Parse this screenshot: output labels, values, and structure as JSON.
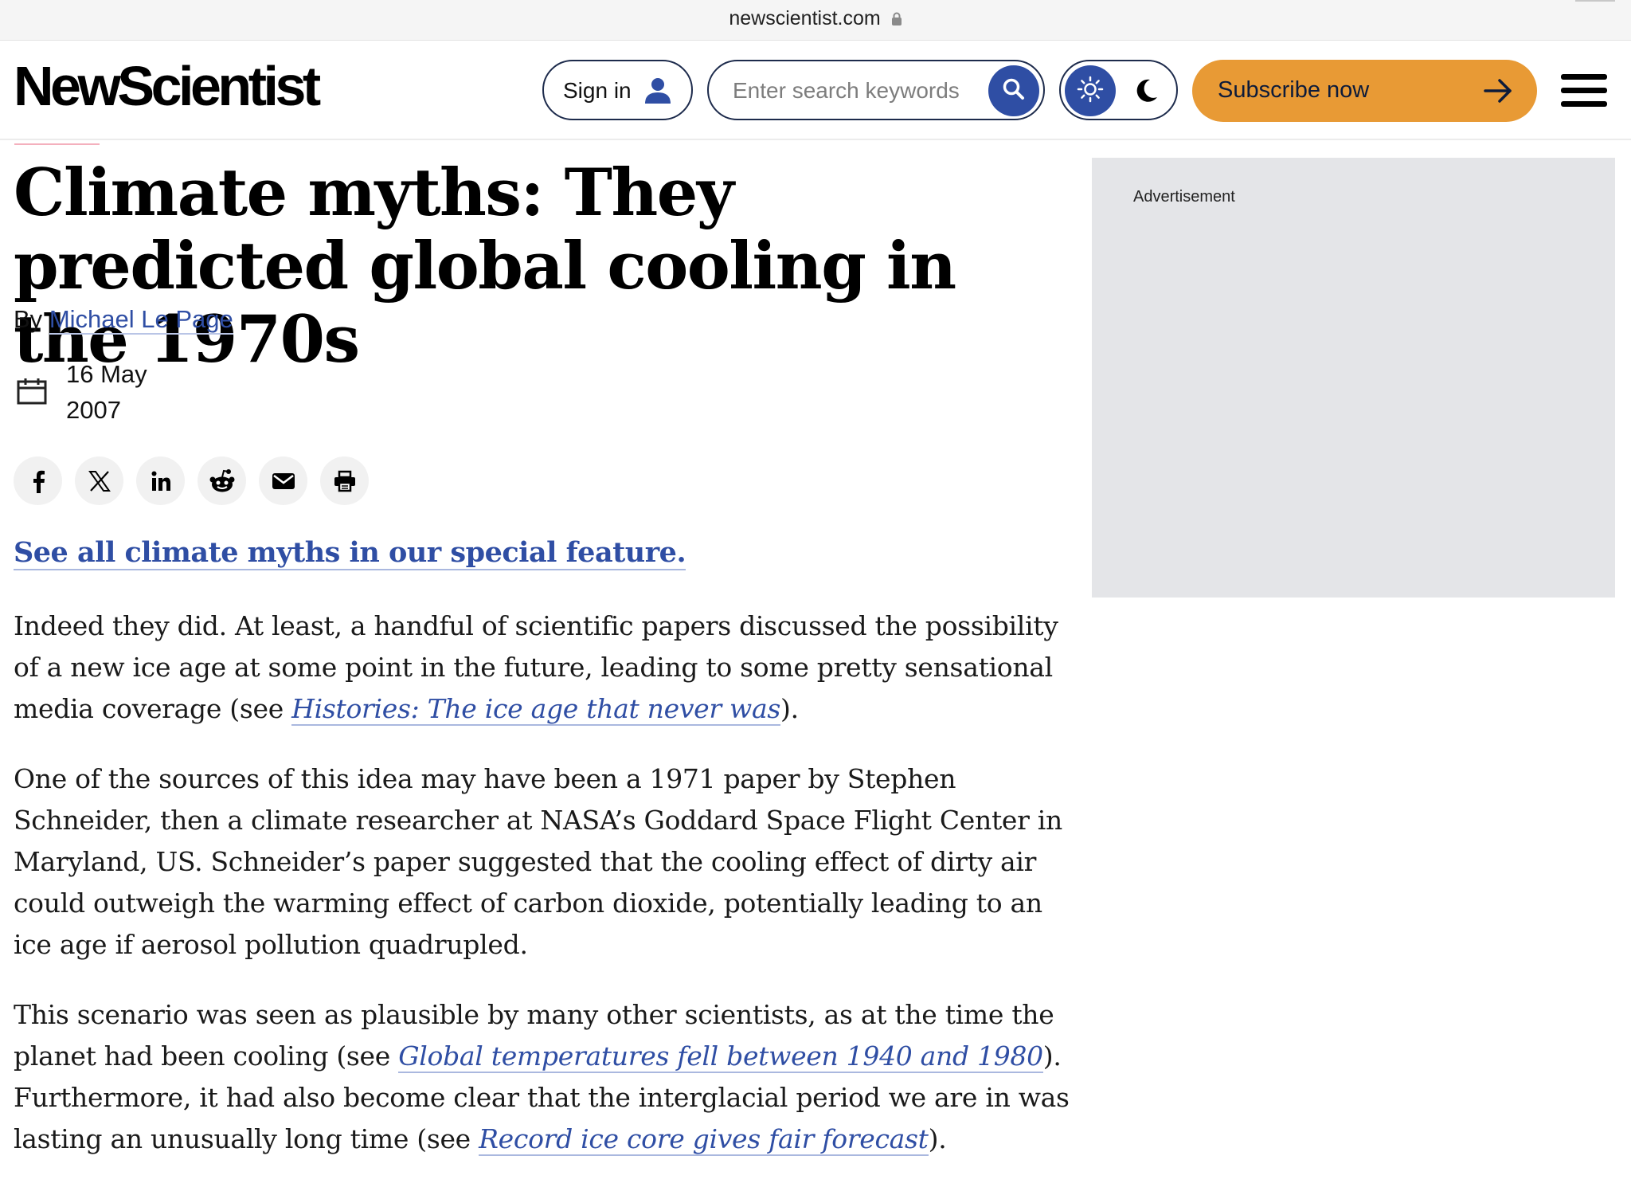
{
  "browser": {
    "url": "newscientist.com"
  },
  "header": {
    "logo": "NewScientist",
    "sign_in_label": "Sign in",
    "search_placeholder": "Enter search keywords",
    "subscribe_label": "Subscribe now"
  },
  "article": {
    "title": "Climate myths: They predicted global cooling in the 1970s",
    "byline_prefix": "By",
    "author": "Michael Le Page",
    "date": "16 May 2007",
    "special_feature_link": "See all climate myths in our special feature.",
    "paragraphs": [
      {
        "before": "Indeed they did. At least, a handful of scientific papers discussed the possibility of a new ice age at some point in the future, leading to some pretty sensational media coverage (see ",
        "link": "Histories: The ice age that never was",
        "after": ")."
      },
      {
        "text": "One of the sources of this idea may have been a 1971 paper by Stephen Schneider, then a climate researcher at NASA’s Goddard Space Flight Center in Maryland, US. Schneider’s paper suggested that the cooling effect of dirty air could outweigh the warming effect of carbon dioxide, potentially leading to an ice age if aerosol pollution quadrupled."
      },
      {
        "before": "This scenario was seen as plausible by many other scientists, as at the time the planet had been cooling (see ",
        "link": "Global temperatures fell between 1940 and 1980",
        "middle": "). Furthermore, it had also become clear that the interglacial period we are in was lasting an unusually long time (see ",
        "link2": "Record ice core gives fair forecast",
        "after": ")."
      }
    ]
  },
  "share_buttons": [
    "facebook-icon",
    "x-icon",
    "linkedin-icon",
    "reddit-icon",
    "email-icon",
    "print-icon"
  ],
  "sidebar": {
    "ad_label": "Advertisement"
  },
  "colors": {
    "accent": "#2f4ea4",
    "subscribe": "#e89a35",
    "ad_bg": "#e4e5e8"
  }
}
